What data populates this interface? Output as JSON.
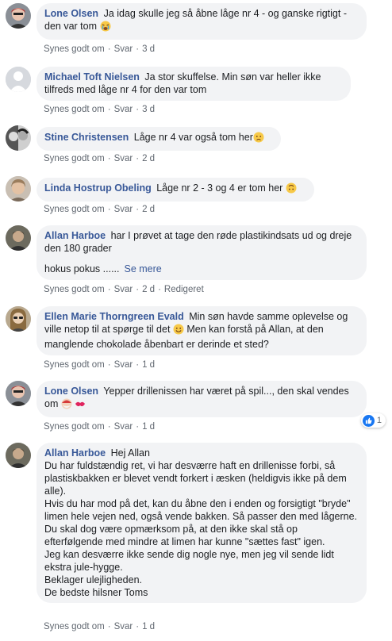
{
  "actions": {
    "like": "Synes godt om",
    "reply": "Svar",
    "edited": "Redigeret"
  },
  "comments": [
    {
      "author": "Lone Olsen",
      "text": "Ja idag skulle jeg så åbne låge nr 4 - og ganske rigtigt - den var tom",
      "emoji": "crying-face-emoji",
      "time": "3 d"
    },
    {
      "author": "Michael Toft Nielsen",
      "text": "Ja stor skuffelse. Min søn var heller ikke tilfreds med låge nr 4 for den var tom",
      "time": "3 d"
    },
    {
      "author": "Stine Christensen",
      "text": "Låge nr 4 var også tom her",
      "emoji": "disappointed-face-emoji",
      "time": "2 d"
    },
    {
      "author": "Linda Hostrup Obeling",
      "text": "Låge nr 2 - 3 og 4 er tom her",
      "emoji": "upside-down-face-emoji",
      "time": "2 d"
    },
    {
      "author": "Allan Harboe",
      "text": "har I prøvet at tage den røde plastikindsats ud og dreje den 180 grader",
      "text2": "hokus pokus ......",
      "see_more": "Se mere",
      "time": "2 d"
    },
    {
      "author": "Ellen Marie Thorngreen Evald",
      "text_a": "Min søn havde samme oplevelse og ville netop til at spørge til det",
      "text_b": "Men kan forstå på Allan, at den manglende chokolade åbenbart er derinde et sted?",
      "emoji": "smiling-face-emoji",
      "time": "1 d"
    },
    {
      "author": "Lone Olsen",
      "text": "Yepper drillenissen har været på spil..., den skal vendes om",
      "emoji": "santa-and-kiss-emoji",
      "reaction_count": "1",
      "time": "1 d"
    },
    {
      "author": "Allan Harboe",
      "lines": [
        "Hej Allan",
        "Du har fuldstændig ret, vi har desværre haft en drillenisse forbi, så plastiskbakken er blevet vendt forkert i æsken (heldigvis ikke på dem alle).",
        "Hvis du har mod på det, kan du åbne den i enden og forsigtigt \"bryde\" limen hele vejen ned, også vende bakken. Så passer den med lågerne.",
        "Du skal dog være opmærksom på, at den ikke skal stå op efterfølgende med mindre at limen har kunne \"sættes fast\" igen.",
        "Jeg kan desværre ikke sende dig nogle nye, men jeg vil sende lidt ekstra jule-hygge.",
        "Beklager ulejligheden.",
        "De bedste hilsner Toms"
      ],
      "time": "1 d"
    }
  ]
}
